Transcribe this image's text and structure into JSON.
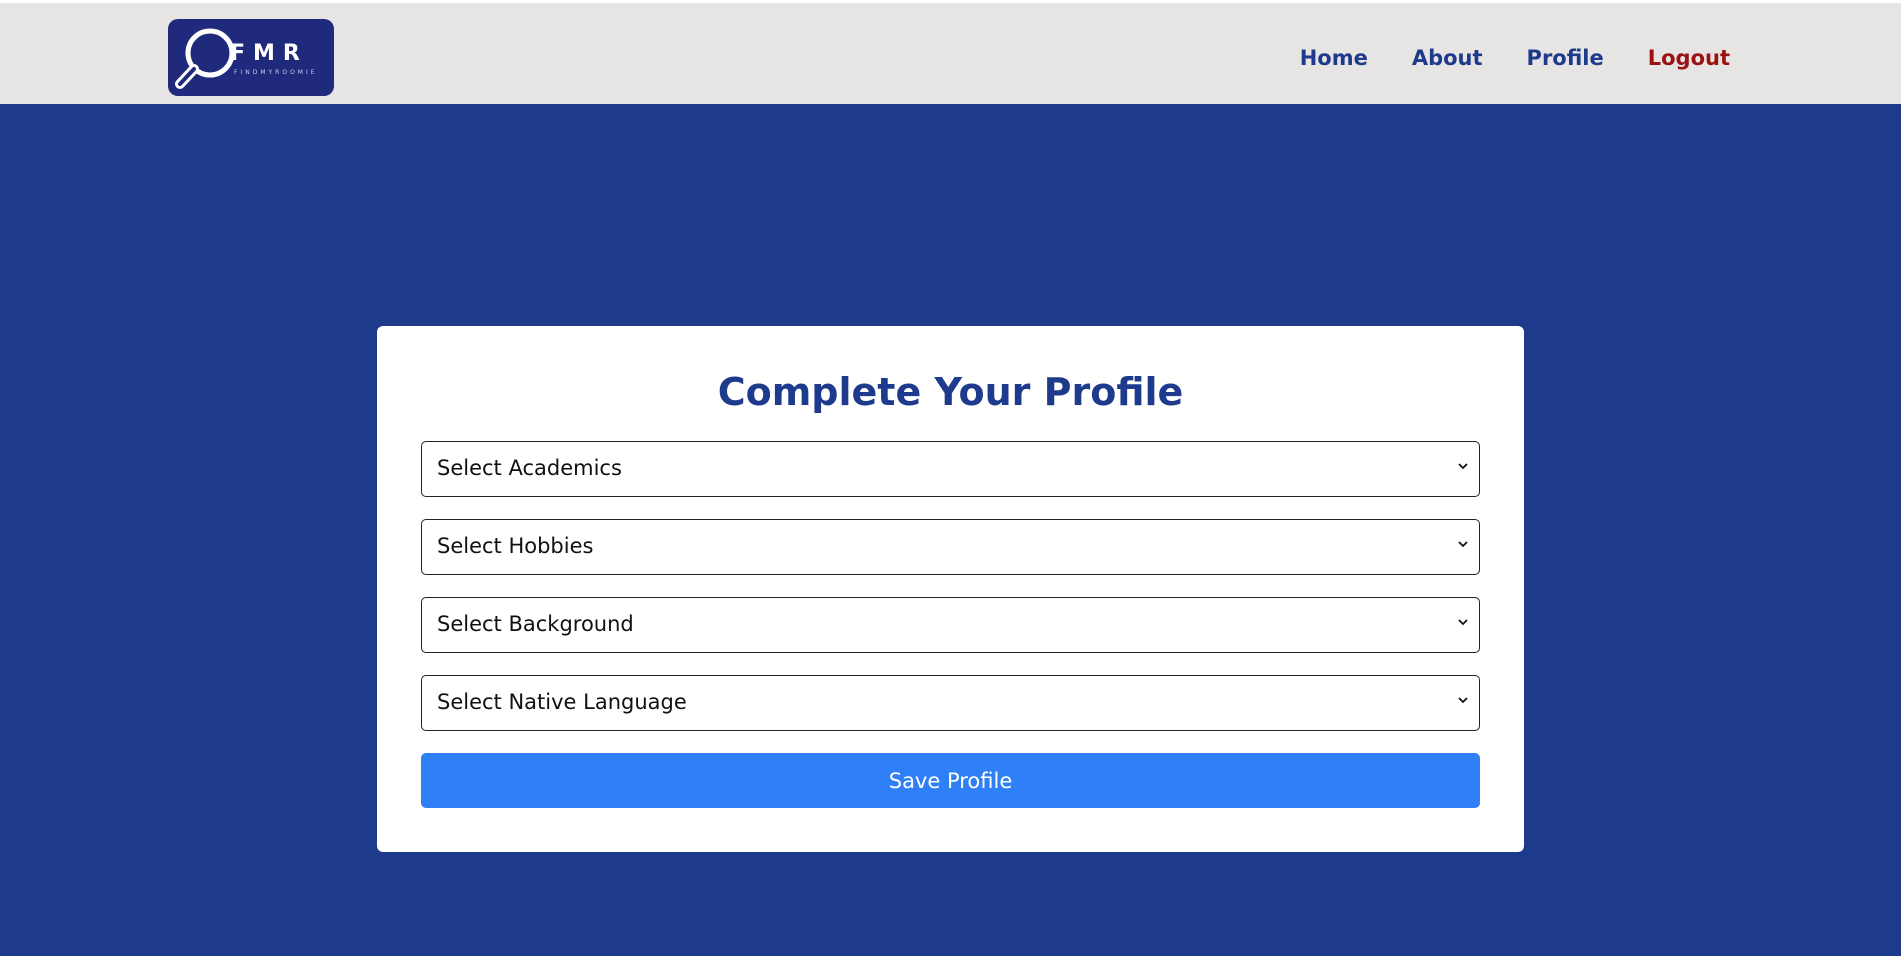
{
  "brand": {
    "logo_text": "FMR",
    "logo_subtitle": "FINDMYROOMIE"
  },
  "nav": {
    "items": [
      {
        "label": "Home"
      },
      {
        "label": "About"
      },
      {
        "label": "Profile"
      },
      {
        "label": "Logout"
      }
    ]
  },
  "form": {
    "title": "Complete Your Profile",
    "selects": [
      {
        "label": "Select Academics"
      },
      {
        "label": "Select Hobbies"
      },
      {
        "label": "Select Background"
      },
      {
        "label": "Select Native Language"
      }
    ],
    "submit_label": "Save Profile"
  },
  "colors": {
    "page_background": "#1e3a8c",
    "header_background": "#e7e5e4",
    "nav_link": "#1e3a8c",
    "logout_link": "#9b1111",
    "primary_button": "#2f7ff7"
  }
}
